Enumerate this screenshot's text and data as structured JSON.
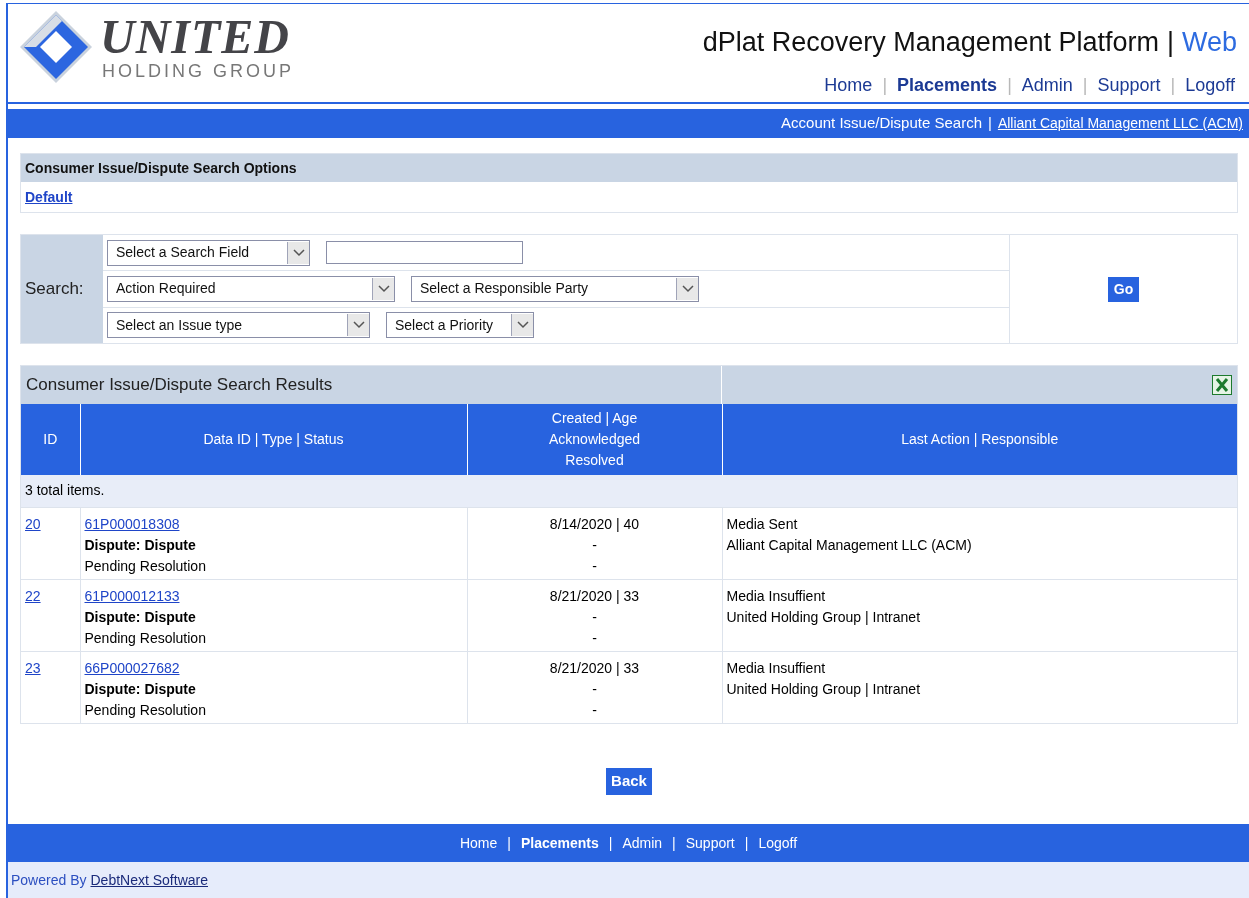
{
  "logo": {
    "name": "UNITED",
    "subtitle": "HOLDING GROUP"
  },
  "header": {
    "title": "dPlat Recovery Management Platform",
    "title_separator": "|",
    "title_suffix": "Web"
  },
  "nav": {
    "separator": "|",
    "items": [
      {
        "label": "Home",
        "selected": false
      },
      {
        "label": "Placements",
        "selected": true
      },
      {
        "label": "Admin",
        "selected": false
      },
      {
        "label": "Support",
        "selected": false
      },
      {
        "label": "Logoff",
        "selected": false
      }
    ]
  },
  "breadcrumb": {
    "page": "Account Issue/Dispute Search",
    "separator": "|",
    "client_link": "Alliant Capital Management LLC (ACM)"
  },
  "search_options": {
    "title": "Consumer Issue/Dispute Search Options",
    "default_link": "Default"
  },
  "search": {
    "label": "Search:",
    "rows": [
      [
        {
          "kind": "dropdown",
          "value": "Select a Search Field"
        },
        {
          "kind": "input"
        }
      ],
      [
        {
          "kind": "dropdown",
          "value": "Action Required"
        },
        {
          "kind": "dropdown",
          "value": "Select a Responsible Party"
        }
      ],
      [
        {
          "kind": "dropdown",
          "value": "Select an Issue type"
        },
        {
          "kind": "dropdown",
          "value": "Select a Priority"
        }
      ]
    ],
    "go_button": "Go"
  },
  "results": {
    "title": "Consumer Issue/Dispute Search Results",
    "columns": [
      [
        "ID"
      ],
      [
        "Data ID | Type | Status"
      ],
      [
        "Created | Age",
        "Acknowledged",
        "Resolved"
      ],
      [
        "Last Action | Responsible"
      ]
    ],
    "total": "3 total items.",
    "rows": [
      {
        "id": "20",
        "data_id": "61P000018308",
        "type": "Dispute: Dispute",
        "status": "Pending Resolution",
        "created": "8/14/2020 | 40",
        "acknowledged": "-",
        "resolved": "-",
        "last_action": "Media Sent",
        "responsible": "Alliant Capital Management LLC (ACM)"
      },
      {
        "id": "22",
        "data_id": "61P000012133",
        "type": "Dispute: Dispute",
        "status": "Pending Resolution",
        "created": "8/21/2020 | 33",
        "acknowledged": "-",
        "resolved": "-",
        "last_action": "Media Insuffient",
        "responsible": "United Holding Group | Intranet"
      },
      {
        "id": "23",
        "data_id": "66P000027682",
        "type": "Dispute: Dispute",
        "status": "Pending Resolution",
        "created": "8/21/2020 | 33",
        "acknowledged": "-",
        "resolved": "-",
        "last_action": "Media Insuffient",
        "responsible": "United Holding Group | Intranet"
      }
    ]
  },
  "back_button": "Back",
  "footer": {
    "separator": "|",
    "items": [
      {
        "label": "Home",
        "selected": false
      },
      {
        "label": "Placements",
        "selected": true
      },
      {
        "label": "Admin",
        "selected": false
      },
      {
        "label": "Support",
        "selected": false
      },
      {
        "label": "Logoff",
        "selected": false
      }
    ],
    "powered_by": "Powered By",
    "powered_link": "DebtNext Software"
  }
}
